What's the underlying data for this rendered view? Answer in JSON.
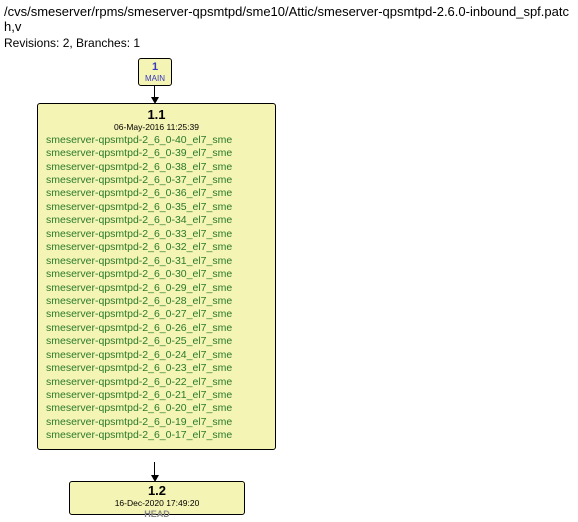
{
  "header": {
    "path": "/cvs/smeserver/rpms/smeserver-qpsmtpd/sme10/Attic/smeserver-qpsmtpd-2.6.0-inbound_spf.patch,v",
    "revisions_line": "Revisions: 2, Branches: 1"
  },
  "nodes": {
    "main": {
      "num": "1",
      "label": "MAIN"
    },
    "r11": {
      "rev": "1.1",
      "timestamp": "06-May-2016 11:25:39",
      "tags": [
        "smeserver-qpsmtpd-2_6_0-40_el7_sme",
        "smeserver-qpsmtpd-2_6_0-39_el7_sme",
        "smeserver-qpsmtpd-2_6_0-38_el7_sme",
        "smeserver-qpsmtpd-2_6_0-37_el7_sme",
        "smeserver-qpsmtpd-2_6_0-36_el7_sme",
        "smeserver-qpsmtpd-2_6_0-35_el7_sme",
        "smeserver-qpsmtpd-2_6_0-34_el7_sme",
        "smeserver-qpsmtpd-2_6_0-33_el7_sme",
        "smeserver-qpsmtpd-2_6_0-32_el7_sme",
        "smeserver-qpsmtpd-2_6_0-31_el7_sme",
        "smeserver-qpsmtpd-2_6_0-30_el7_sme",
        "smeserver-qpsmtpd-2_6_0-29_el7_sme",
        "smeserver-qpsmtpd-2_6_0-28_el7_sme",
        "smeserver-qpsmtpd-2_6_0-27_el7_sme",
        "smeserver-qpsmtpd-2_6_0-26_el7_sme",
        "smeserver-qpsmtpd-2_6_0-25_el7_sme",
        "smeserver-qpsmtpd-2_6_0-24_el7_sme",
        "smeserver-qpsmtpd-2_6_0-23_el7_sme",
        "smeserver-qpsmtpd-2_6_0-22_el7_sme",
        "smeserver-qpsmtpd-2_6_0-21_el7_sme",
        "smeserver-qpsmtpd-2_6_0-20_el7_sme",
        "smeserver-qpsmtpd-2_6_0-19_el7_sme",
        "smeserver-qpsmtpd-2_6_0-17_el7_sme"
      ]
    },
    "r12": {
      "rev": "1.2",
      "timestamp": "16-Dec-2020 17:49:20",
      "head": "HEAD"
    }
  }
}
